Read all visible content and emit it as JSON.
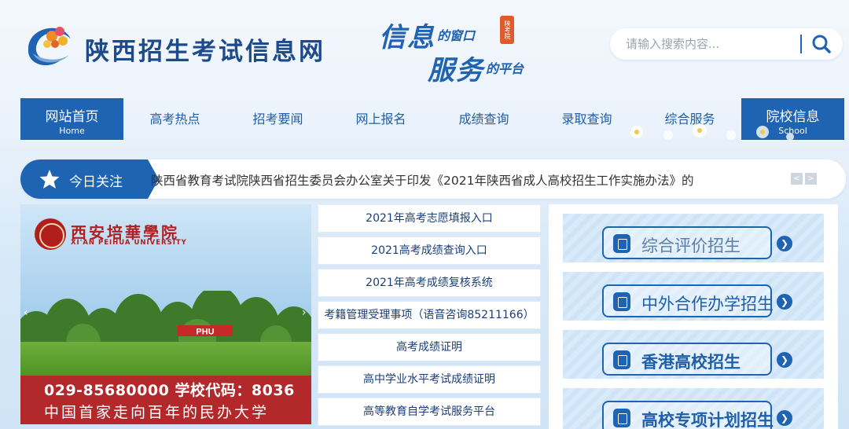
{
  "header": {
    "site_title": "陕西招生考试信息网",
    "slogan": {
      "line1_big": "信息",
      "line1_small": "的窗口",
      "line2_big": "服务",
      "line2_small": "的平台",
      "stamp": "陕考院"
    },
    "search_placeholder": "请输入搜索内容..."
  },
  "nav": {
    "home": {
      "label": "网站首页",
      "sub": "Home"
    },
    "items": [
      "高考热点",
      "招考要闻",
      "网上报名",
      "成绩查询",
      "录取查询",
      "综合服务"
    ],
    "school": {
      "label": "院校信息",
      "sub": "School"
    }
  },
  "ticker": {
    "label": "今日关注",
    "text": "陕西省教育考试院陕西省招生委员会办公室关于印发《2021年陕西省成人高校招生工作实施办法》的",
    "prev": "<",
    "next": ">"
  },
  "banner": {
    "name": "西安培華學院",
    "name_en": "XI'AN PEIHUA UNIVERSITY",
    "sign": "PHU",
    "phone_line": "029-85680000  学校代码：8036",
    "motto": "中国首家走向百年的民办大学"
  },
  "links": [
    "2021年高考志愿填报入口",
    "2021高考成绩查询入口",
    "2021年高考成绩复核系统",
    "考籍管理受理事项（语音咨询85211166）",
    "高考成绩证明",
    "高中学业水平考试成绩证明",
    "高等教育自学考试服务平台"
  ],
  "services": [
    {
      "label": "综合评价招生",
      "color": "#5b7fa8"
    },
    {
      "label": "中外合作办学招生",
      "color": "#1f5ea8"
    },
    {
      "label": "香港高校招生",
      "color": "#1f5ea8"
    },
    {
      "label": "高校专项计划招生",
      "color": "#1f5ea8"
    }
  ],
  "colors": {
    "primary": "#1f63b3",
    "banner_red": "#b2282b"
  }
}
